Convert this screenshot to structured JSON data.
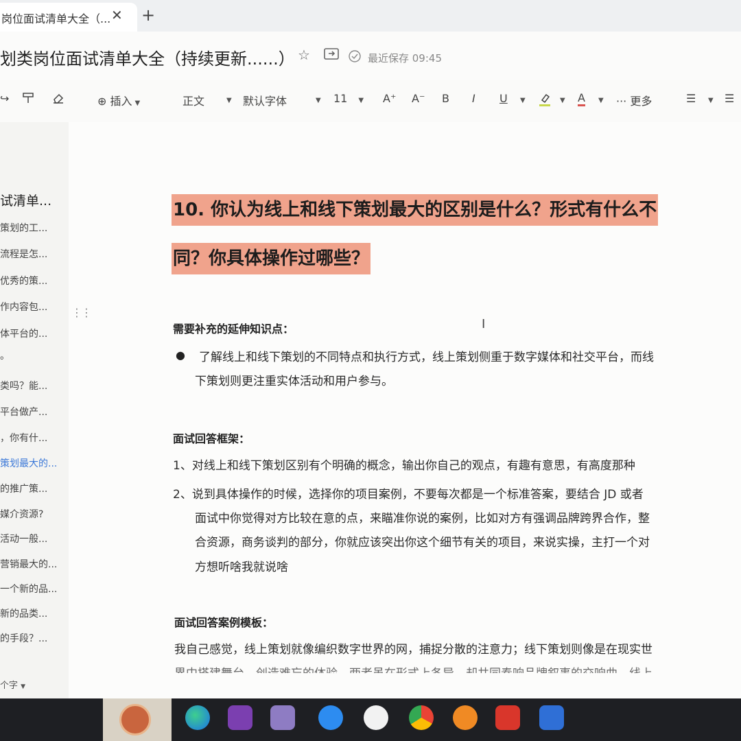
{
  "tab": {
    "title": "岗位面试清单大全（...",
    "close": "✕",
    "new": "+"
  },
  "header": {
    "title": "划类岗位面试清单大全（持续更新......）",
    "saved_status": "最近保存 09:45"
  },
  "toolbar": {
    "insert": "插入",
    "paragraph_style": "正文",
    "font": "默认字体",
    "font_size": "11",
    "grow": "A⁺",
    "shrink": "A⁻",
    "bold": "B",
    "italic": "I",
    "underline": "U",
    "font_color": "A",
    "more_dots": "···",
    "more": "更多"
  },
  "sidebar": {
    "title": "试清单...",
    "items": [
      "策划的工...",
      "流程是怎...",
      "优秀的策...",
      "作内容包...",
      "体平台的...",
      "。",
      "类吗？能...",
      "平台做产...",
      "，你有什...",
      "策划最大的...",
      "的推广策...",
      "媒介资源?",
      "活动一般...",
      "营销最大的...",
      "一个新的品...",
      "新的品类...",
      "的手段？..."
    ],
    "word_count": "个字"
  },
  "doc": {
    "heading_line1": "10. 你认为线上和线下策划最大的区别是什么？形式有什么不",
    "heading_line2": "同？你具体操作过哪些？",
    "section1_title": "需要补充的延伸知识点：",
    "bullet_mark": "●",
    "bullet1_line1": "了解线上和线下策划的不同特点和执行方式，线上策划侧重于数字媒体和社交平台，而线",
    "bullet1_line2": "下策划则更注重实体活动和用户参与。",
    "section2_title": "面试回答框架：",
    "item1": "1、对线上和线下策划区别有个明确的概念，输出你自己的观点，有趣有意思，有高度那种",
    "item2_line1": "2、说到具体操作的时候，选择你的项目案例，不要每次都是一个标准答案，要结合 JD 或者",
    "item2_line2": "面试中你觉得对方比较在意的点，来瞄准你说的案例，比如对方有强调品牌跨界合作，整",
    "item2_line3": "合资源，商务谈判的部分，你就应该突出你这个细节有关的项目，来说实操，主打一个对",
    "item2_line4": "方想听啥我就说啥",
    "section3_title": "面试回答案例模板：",
    "example_line1": "我自己感觉，线上策划就像编织数字世界的网，捕捉分散的注意力；线下策划则像是在现实世",
    "example_line2": "界中搭建舞台，创造难忘的体验。两者虽在形式上各异，却共同奏响品牌叙事的交响曲。线上"
  },
  "colors": {
    "highlight": "#f0a38c",
    "active_link": "#3b78d8",
    "taskbar": "#1e1f23"
  },
  "taskbar_apps": [
    "edge-icon",
    "onenote-icon",
    "notes-icon",
    "sogou-icon",
    "app-icon",
    "chrome-icon",
    "search-icon",
    "wps-icon",
    "typora-icon"
  ]
}
